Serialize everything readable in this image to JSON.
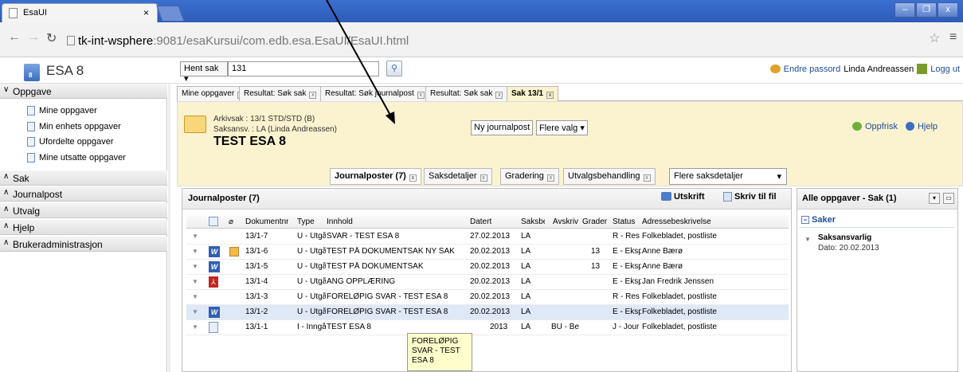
{
  "browser": {
    "tab_title": "EsaUI",
    "tab_close": "×",
    "url_host": "tk-int-wsphere",
    "url_rest": ":9081/esaKursui/com.edb.esa.EsaUI/EsaUI.html",
    "win_min": "–",
    "win_max": "❐",
    "win_close": "x"
  },
  "app": {
    "logo_text": "8",
    "title": "ESA 8",
    "search_type": "Hent sak ▾",
    "search_value": "131",
    "change_password": "Endre passord",
    "user_name": "Linda Andreassen",
    "logout": "Logg ut"
  },
  "sidebar": {
    "sections": [
      {
        "label": "Oppgave",
        "chev": "∨"
      },
      {
        "label": "Sak",
        "chev": "∧"
      },
      {
        "label": "Journalpost",
        "chev": "∧"
      },
      {
        "label": "Utvalg",
        "chev": "∧"
      },
      {
        "label": "Hjelp",
        "chev": "∧"
      },
      {
        "label": "Brukeradministrasjon",
        "chev": "∧"
      }
    ],
    "oppgave_items": [
      "Mine oppgaver",
      "Min enhets oppgaver",
      "Ufordelte oppgaver",
      "Mine utsatte oppgaver"
    ]
  },
  "main_tabs": [
    "Mine oppgaver",
    "Resultat: Søk sak",
    "Resultat: Søk journalpost",
    "Resultat: Søk sak",
    "Sak 13/1"
  ],
  "case": {
    "arkivsak": "Arkivsak :   13/1 STD/STD (B)",
    "saksansv": "Saksansv. : LA (Linda Andreassen)",
    "title": "TEST ESA 8",
    "new_journalpost": "Ny journalpost",
    "more_options": "Flere valg ▾",
    "refresh": "Oppfrisk",
    "help": "Hjelp"
  },
  "detail_tabs": [
    "Journalposter (7)",
    "Saksdetaljer",
    "Gradering",
    "Utvalgsbehandling"
  ],
  "detail_more": "Flere saksdetaljer",
  "journal": {
    "title": "Journalposter (7)",
    "print": "Utskrift",
    "write_file": "Skriv til fil",
    "columns": [
      "Dokumentnr",
      "Type",
      "Innhold",
      "Datert",
      "Saksbe",
      "Avskriv",
      "Grader",
      "Status",
      "Adressebeskrivelse"
    ],
    "rows": [
      {
        "icon": "",
        "att": "",
        "nr": "13/1-7",
        "type": "U - Utgå",
        "innhold": "SVAR - TEST ESA 8",
        "datert": "27.02.2013",
        "saksbe": "LA",
        "avskriv": "",
        "grader": "",
        "status": "R - Res",
        "adresse": "Folkebladet, postliste"
      },
      {
        "icon": "W",
        "att": "yes",
        "nr": "13/1-6",
        "type": "U - Utgå",
        "innhold": "TEST PÅ DOKUMENTSAK NY SAK",
        "datert": "20.02.2013",
        "saksbe": "LA",
        "avskriv": "",
        "grader": "13",
        "status": "E - Eksp",
        "adresse": "Anne Bærø"
      },
      {
        "icon": "W",
        "att": "",
        "nr": "13/1-5",
        "type": "U - Utgå",
        "innhold": "TEST PÅ DOKUMENTSAK",
        "datert": "20.02.2013",
        "saksbe": "LA",
        "avskriv": "",
        "grader": "13",
        "status": "E - Eksp",
        "adresse": "Anne Bærø"
      },
      {
        "icon": "PDF",
        "att": "",
        "nr": "13/1-4",
        "type": "U - Utgå",
        "innhold": "ANG OPPLÆRING",
        "datert": "20.02.2013",
        "saksbe": "LA",
        "avskriv": "",
        "grader": "",
        "status": "E - Eksp",
        "adresse": "Jan Fredrik Jenssen"
      },
      {
        "icon": "",
        "att": "",
        "nr": "13/1-3",
        "type": "U - Utgå",
        "innhold": "FORELØPIG SVAR - TEST ESA 8",
        "datert": "20.02.2013",
        "saksbe": "LA",
        "avskriv": "",
        "grader": "",
        "status": "R - Res",
        "adresse": "Folkebladet, postliste"
      },
      {
        "icon": "W",
        "att": "",
        "nr": "13/1-2",
        "type": "U - Utgå",
        "innhold": "FORELØPIG SVAR - TEST ESA 8",
        "datert": "20.02.2013",
        "saksbe": "LA",
        "avskriv": "",
        "grader": "",
        "status": "E - Eksp",
        "adresse": "Folkebladet, postliste"
      },
      {
        "icon": "blank",
        "att": "",
        "nr": "13/1-1",
        "type": "I - Inngå",
        "innhold": "TEST ESA 8",
        "datert": "2013",
        "saksbe": "LA",
        "avskriv": "BU - Be",
        "grader": "",
        "status": "J - Jour",
        "adresse": "Folkebladet, postliste"
      }
    ],
    "tooltip": "FORELØPIG SVAR - TEST ESA 8"
  },
  "right": {
    "title": "Alle oppgaver - Sak (1)",
    "group": "Saker",
    "item_title": "Saksansvarlig",
    "item_date": "Dato: 20.02.2013"
  }
}
